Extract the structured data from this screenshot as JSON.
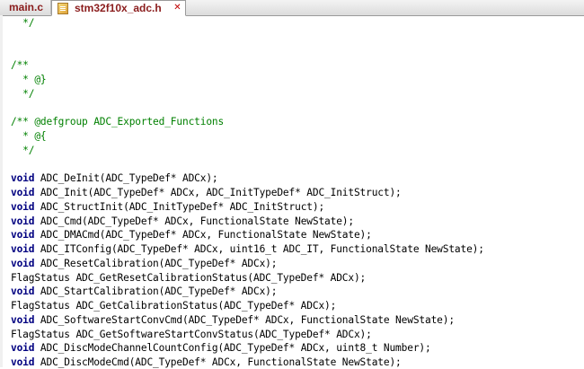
{
  "tabs": [
    {
      "label": "main.c"
    },
    {
      "label": "stm32f10x_adc.h"
    }
  ],
  "code_lines": [
    {
      "kind": "comment",
      "text": "  */"
    },
    {
      "kind": "blank",
      "text": ""
    },
    {
      "kind": "blank",
      "text": ""
    },
    {
      "kind": "comment",
      "text": "/**"
    },
    {
      "kind": "comment",
      "text": "  * @}"
    },
    {
      "kind": "comment",
      "text": "  */"
    },
    {
      "kind": "blank",
      "text": ""
    },
    {
      "kind": "comment",
      "text": "/** @defgroup ADC_Exported_Functions"
    },
    {
      "kind": "comment",
      "text": "  * @{"
    },
    {
      "kind": "comment",
      "text": "  */"
    },
    {
      "kind": "blank",
      "text": ""
    },
    {
      "kind": "code",
      "kw": "void",
      "text": " ADC_DeInit(ADC_TypeDef* ADCx);"
    },
    {
      "kind": "code",
      "kw": "void",
      "text": " ADC_Init(ADC_TypeDef* ADCx, ADC_InitTypeDef* ADC_InitStruct);"
    },
    {
      "kind": "code",
      "kw": "void",
      "text": " ADC_StructInit(ADC_InitTypeDef* ADC_InitStruct);"
    },
    {
      "kind": "code",
      "kw": "void",
      "text": " ADC_Cmd(ADC_TypeDef* ADCx, FunctionalState NewState);"
    },
    {
      "kind": "code",
      "kw": "void",
      "text": " ADC_DMACmd(ADC_TypeDef* ADCx, FunctionalState NewState);"
    },
    {
      "kind": "code",
      "kw": "void",
      "text": " ADC_ITConfig(ADC_TypeDef* ADCx, uint16_t ADC_IT, FunctionalState NewState);"
    },
    {
      "kind": "code",
      "kw": "void",
      "text": " ADC_ResetCalibration(ADC_TypeDef* ADCx);"
    },
    {
      "kind": "code",
      "kw": "",
      "text": "FlagStatus ADC_GetResetCalibrationStatus(ADC_TypeDef* ADCx);"
    },
    {
      "kind": "code",
      "kw": "void",
      "text": " ADC_StartCalibration(ADC_TypeDef* ADCx);"
    },
    {
      "kind": "code",
      "kw": "",
      "text": "FlagStatus ADC_GetCalibrationStatus(ADC_TypeDef* ADCx);"
    },
    {
      "kind": "code",
      "kw": "void",
      "text": " ADC_SoftwareStartConvCmd(ADC_TypeDef* ADCx, FunctionalState NewState);"
    },
    {
      "kind": "code",
      "kw": "",
      "text": "FlagStatus ADC_GetSoftwareStartConvStatus(ADC_TypeDef* ADCx);"
    },
    {
      "kind": "code",
      "kw": "void",
      "text": " ADC_DiscModeChannelCountConfig(ADC_TypeDef* ADCx, uint8_t Number);"
    },
    {
      "kind": "code",
      "kw": "void",
      "text": " ADC_DiscModeCmd(ADC_TypeDef* ADCx, FunctionalState NewState);"
    }
  ],
  "colors": {
    "comment": "#008000",
    "keyword": "#000080",
    "tab_text": "#8a1c1c"
  },
  "icons": [
    "file-icon",
    "close-icon"
  ]
}
